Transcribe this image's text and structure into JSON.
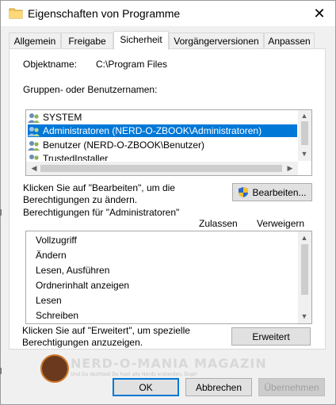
{
  "window": {
    "title": "Eigenschaften von Programme",
    "close_glyph": "✕"
  },
  "tabs": [
    {
      "label": "Allgemein"
    },
    {
      "label": "Freigabe"
    },
    {
      "label": "Sicherheit"
    },
    {
      "label": "Vorgängerversionen"
    },
    {
      "label": "Anpassen"
    }
  ],
  "active_tab": "Sicherheit",
  "object": {
    "label": "Objektname:",
    "value": "C:\\Program Files"
  },
  "groups": {
    "label": "Gruppen- oder Benutzernamen:",
    "items": [
      {
        "name": "SYSTEM",
        "icon": "users-icon"
      },
      {
        "name": "Administratoren (NERD-O-ZBOOK\\Administratoren)",
        "icon": "users-icon"
      },
      {
        "name": "Benutzer (NERD-O-ZBOOK\\Benutzer)",
        "icon": "users-icon"
      },
      {
        "name": "TrustedInstaller",
        "icon": "users-icon"
      }
    ],
    "selected_index": 1
  },
  "edit": {
    "hint": "Klicken Sie auf \"Bearbeiten\", um die\nBerechtigungen zu ändern.",
    "hint_line1": "Klicken Sie auf \"Bearbeiten\", um die",
    "hint_line2": "Berechtigungen zu ändern.",
    "button_label": "Bearbeiten...",
    "button_icon": "shield-icon"
  },
  "permissions": {
    "label": "Berechtigungen für \"Administratoren\"",
    "col_allow": "Zulassen",
    "col_deny": "Verweigern",
    "rows": [
      {
        "name": "Vollzugriff"
      },
      {
        "name": "Ändern"
      },
      {
        "name": "Lesen, Ausführen"
      },
      {
        "name": "Ordnerinhalt anzeigen"
      },
      {
        "name": "Lesen"
      },
      {
        "name": "Schreiben"
      }
    ]
  },
  "advanced": {
    "hint_line1": "Klicken Sie auf \"Erweitert\", um spezielle",
    "hint_line2": "Berechtigungen anzuzeigen.",
    "button_label": "Erweitert"
  },
  "footer": {
    "ok_label": "OK",
    "cancel_label": "Abbrechen",
    "apply_label": "Übernehmen"
  },
  "watermark": {
    "text": "NERD-O-MANIA MAGAZIN",
    "tagline": "Und Du dachtest Du hast alle Nerds erstanden, Dupi!"
  },
  "colors": {
    "selection": "#0078d7",
    "dialog_bg": "#f0f0f0",
    "button_bg": "#e1e1e1"
  }
}
